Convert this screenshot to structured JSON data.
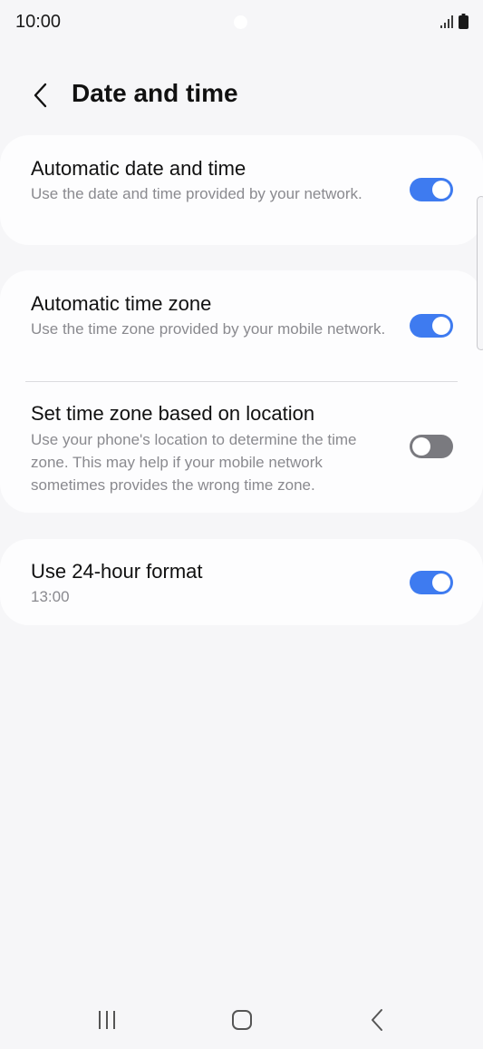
{
  "status_bar": {
    "time": "10:00",
    "icons": [
      "camera-dot",
      "signal-icon",
      "battery-icon"
    ]
  },
  "header": {
    "title": "Date and time",
    "back_icon": "chevron-left-icon"
  },
  "settings": [
    {
      "title": "Automatic date and time",
      "description": "Use the date and time provided by your network.",
      "enabled": true
    },
    {
      "title": "Automatic time zone",
      "description": "Use the time zone provided by your mobile network.",
      "enabled": true
    },
    {
      "title": "Set time zone based on location",
      "description": "Use your phone's location to determine the time zone. This may help if your mobile network sometimes provides the wrong time zone.",
      "enabled": false
    },
    {
      "title": "Use 24-hour format",
      "description": "13:00",
      "enabled": true
    }
  ],
  "nav_bar": {
    "icons": [
      "recent-apps-icon",
      "home-icon",
      "back-icon"
    ]
  },
  "colors": {
    "background": "#f6f6f8",
    "card": "#fdfdfe",
    "toggle_on": "#3e7bf0",
    "toggle_off": "#7a7a7f",
    "secondary_text": "#8a8a8f"
  }
}
